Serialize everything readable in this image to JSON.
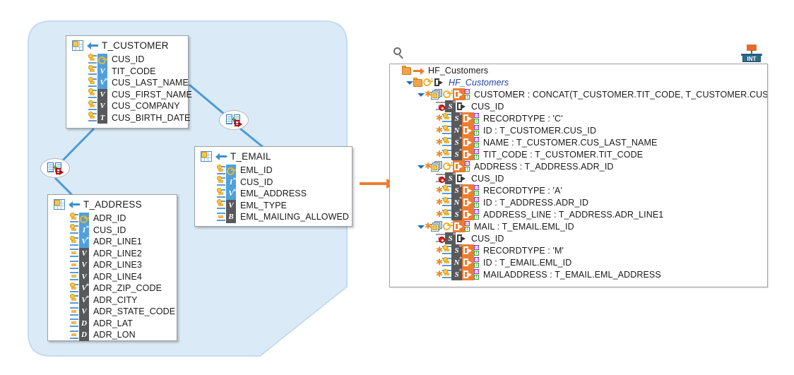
{
  "diagram": {
    "tables": [
      {
        "name": "T_CUSTOMER",
        "columns": [
          {
            "name": "CUS_ID",
            "type": "I",
            "badge": "key",
            "key": true,
            "starred": true,
            "indexed": true
          },
          {
            "name": "TIT_CODE",
            "type": "V",
            "badge": "blue",
            "key": false,
            "starred": false,
            "indexed": true
          },
          {
            "name": "CUS_LAST_NAME",
            "type": "V",
            "badge": "blue",
            "key": false,
            "starred": true,
            "indexed": true
          },
          {
            "name": "CUS_FIRST_NAME",
            "type": "V",
            "badge": "gray",
            "key": false,
            "starred": false,
            "indexed": true
          },
          {
            "name": "CUS_COMPANY",
            "type": "V",
            "badge": "gray",
            "key": false,
            "starred": false,
            "indexed": true
          },
          {
            "name": "CUS_BIRTH_DATE",
            "type": "T",
            "badge": "gray",
            "key": false,
            "starred": false,
            "indexed": true
          }
        ]
      },
      {
        "name": "T_EMAIL",
        "columns": [
          {
            "name": "EML_ID",
            "type": "I",
            "badge": "key",
            "key": true,
            "starred": true,
            "indexed": true
          },
          {
            "name": "CUS_ID",
            "type": "I",
            "badge": "blue",
            "key": false,
            "starred": true,
            "indexed": true
          },
          {
            "name": "EML_ADDRESS",
            "type": "V",
            "badge": "blue",
            "key": false,
            "starred": true,
            "indexed": true
          },
          {
            "name": "EML_TYPE",
            "type": "V",
            "badge": "gray",
            "key": false,
            "starred": false,
            "indexed": true
          },
          {
            "name": "EML_MAILING_ALLOWED",
            "type": "B",
            "badge": "gray",
            "key": false,
            "starred": false,
            "indexed": false
          }
        ]
      },
      {
        "name": "T_ADDRESS",
        "columns": [
          {
            "name": "ADR_ID",
            "type": "I",
            "badge": "key",
            "key": true,
            "starred": true,
            "indexed": true
          },
          {
            "name": "CUS_ID",
            "type": "I",
            "badge": "blue",
            "key": false,
            "starred": true,
            "indexed": true
          },
          {
            "name": "ADR_LINE1",
            "type": "V",
            "badge": "blue",
            "key": false,
            "starred": true,
            "indexed": true
          },
          {
            "name": "ADR_LINE2",
            "type": "V",
            "badge": "gray",
            "key": false,
            "starred": false,
            "indexed": false
          },
          {
            "name": "ADR_LINE3",
            "type": "V",
            "badge": "gray",
            "key": false,
            "starred": false,
            "indexed": false
          },
          {
            "name": "ADR_LINE4",
            "type": "V",
            "badge": "gray",
            "key": false,
            "starred": false,
            "indexed": false
          },
          {
            "name": "ADR_ZIP_CODE",
            "type": "V",
            "badge": "gray",
            "key": false,
            "starred": true,
            "indexed": true
          },
          {
            "name": "ADR_CITY",
            "type": "V",
            "badge": "gray",
            "key": false,
            "starred": true,
            "indexed": true
          },
          {
            "name": "ADR_STATE_CODE",
            "type": "V",
            "badge": "gray",
            "key": false,
            "starred": false,
            "indexed": false
          },
          {
            "name": "ADR_LAT",
            "type": "D",
            "badge": "gray",
            "key": false,
            "starred": false,
            "indexed": false
          },
          {
            "name": "ADR_LON",
            "type": "D",
            "badge": "gray",
            "key": false,
            "starred": false,
            "indexed": false
          }
        ]
      }
    ],
    "relationship_nodes": 2
  },
  "tree_panel": {
    "search_placeholder": "",
    "root": "HF_Customers",
    "rows": [
      {
        "indent": 0,
        "label": "HF_Customers",
        "style": "root",
        "twisty": "none",
        "icons": [
          "folder-icon",
          "arrow-right-orange-icon"
        ]
      },
      {
        "indent": 1,
        "label": "HF_Customers",
        "style": "italic",
        "twisty": "open",
        "icons": [
          "folder-icon",
          "key-icon",
          "output-white-icon"
        ]
      },
      {
        "indent": 2,
        "label": "CUSTOMER : CONCAT(T_CUSTOMER.TIT_CODE, T_CUSTOMER.CUS_ID)",
        "style": "normal",
        "twisty": "open",
        "icons": [
          "star",
          "stack-icon",
          "key-icon",
          "output-orange-icon",
          "ui-badge-icon"
        ]
      },
      {
        "indent": 3,
        "label": "CUS_ID",
        "style": "normal",
        "twisty": "none",
        "icons": [
          "column-gear-red-icon",
          "s-type-icon",
          "output-white-icon"
        ]
      },
      {
        "indent": 3,
        "label": "RECORDTYPE : 'C'",
        "style": "normal",
        "twisty": "none",
        "icons": [
          "star",
          "column-icon",
          "s-type-icon",
          "output-orange-icon",
          "ui-badge-icon"
        ]
      },
      {
        "indent": 3,
        "label": "ID : T_CUSTOMER.CUS_ID",
        "style": "normal",
        "twisty": "none",
        "icons": [
          "star",
          "column-icon",
          "n-type-icon",
          "output-orange-icon",
          "ui-badge-icon"
        ]
      },
      {
        "indent": 3,
        "label": "NAME : T_CUSTOMER.CUS_LAST_NAME",
        "style": "normal",
        "twisty": "none",
        "icons": [
          "star",
          "column-icon",
          "s-type-icon",
          "output-orange-icon",
          "ui-badge-icon"
        ]
      },
      {
        "indent": 3,
        "label": "TIT_CODE : T_CUSTOMER.TIT_CODE",
        "style": "normal",
        "twisty": "none",
        "icons": [
          "star",
          "column-icon",
          "s-type-icon",
          "output-orange-icon",
          "ui-badge-icon"
        ]
      },
      {
        "indent": 2,
        "label": "ADDRESS : T_ADDRESS.ADR_ID",
        "style": "normal",
        "twisty": "open",
        "icons": [
          "star",
          "stack-icon",
          "key-icon",
          "output-orange-icon",
          "ui-badge-icon"
        ]
      },
      {
        "indent": 3,
        "label": "CUS_ID",
        "style": "normal",
        "twisty": "none",
        "icons": [
          "column-gear-red-icon",
          "s-type-icon",
          "output-white-icon"
        ]
      },
      {
        "indent": 3,
        "label": "RECORDTYPE : 'A'",
        "style": "normal",
        "twisty": "none",
        "icons": [
          "star",
          "column-icon",
          "s-type-icon",
          "output-orange-icon",
          "ui-badge-icon"
        ]
      },
      {
        "indent": 3,
        "label": "ID : T_ADDRESS.ADR_ID",
        "style": "normal",
        "twisty": "none",
        "icons": [
          "star",
          "column-icon",
          "n-type-icon",
          "output-orange-icon",
          "ui-badge-icon"
        ]
      },
      {
        "indent": 3,
        "label": "ADDRESS_LINE : T_ADDRESS.ADR_LINE1",
        "style": "normal",
        "twisty": "none",
        "icons": [
          "star",
          "column-icon",
          "s-type-icon",
          "output-orange-icon",
          "ui-badge-icon"
        ]
      },
      {
        "indent": 2,
        "label": "MAIL : T_EMAIL.EML_ID",
        "style": "normal",
        "twisty": "open",
        "icons": [
          "star",
          "stack-icon",
          "key-icon",
          "output-orange-icon",
          "ui-badge-icon"
        ]
      },
      {
        "indent": 3,
        "label": "CUS_ID",
        "style": "normal",
        "twisty": "none",
        "icons": [
          "column-gear-red-icon",
          "s-type-icon",
          "output-white-icon"
        ]
      },
      {
        "indent": 3,
        "label": "RECORDTYPE : 'M'",
        "style": "normal",
        "twisty": "none",
        "icons": [
          "star",
          "column-icon",
          "s-type-icon",
          "output-orange-icon",
          "ui-badge-icon"
        ]
      },
      {
        "indent": 3,
        "label": "ID : T_EMAIL.EML_ID",
        "style": "normal",
        "twisty": "none",
        "icons": [
          "star",
          "column-icon",
          "n-type-icon",
          "output-orange-icon",
          "ui-badge-icon"
        ]
      },
      {
        "indent": 3,
        "label": "MAILADDRESS : T_EMAIL.EML_ADDRESS",
        "style": "normal",
        "twisty": "none",
        "icons": [
          "star",
          "column-icon",
          "s-type-icon",
          "output-orange-icon",
          "ui-badge-icon"
        ]
      }
    ],
    "int_icon_label": "INT"
  },
  "colors": {
    "group_fill": "#dbeaf7",
    "connector_blue": "#5b9bd5",
    "flow_arrow_orange": "#ed7d31",
    "badge_blue": "#50a0dc",
    "badge_gray": "#58595b",
    "tree_link_blue": "#1f3fa8"
  }
}
